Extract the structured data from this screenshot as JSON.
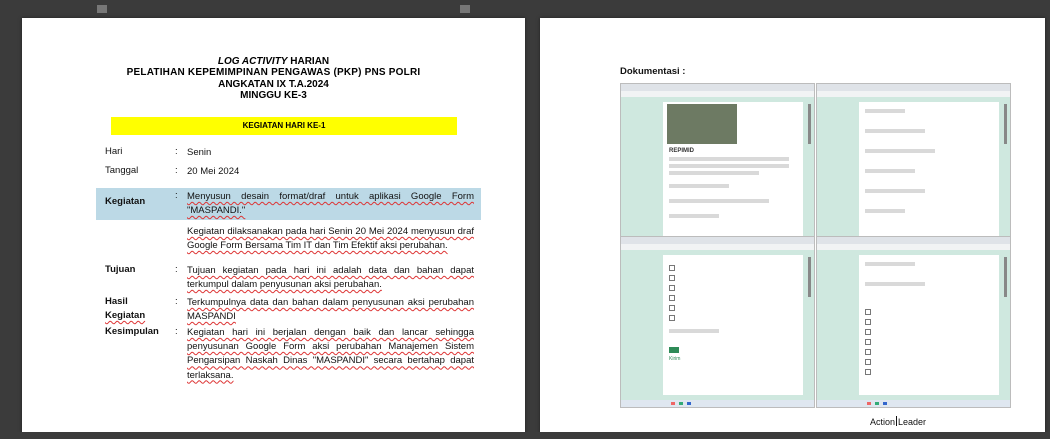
{
  "page1": {
    "title_italic": "LOG ACTIVITY",
    "title_rest": " HARIAN",
    "title_line2": "PELATIHAN KEPEMIMPINAN PENGAWAS (PKP) PNS POLRI",
    "title_line3": "ANGKATAN IX T.A.2024",
    "title_line4": "MINGGU KE-3",
    "day_banner": "KEGIATAN HARI KE-1",
    "rows": {
      "hari": {
        "label": "Hari",
        "value": "Senin"
      },
      "tanggal": {
        "label": "Tanggal",
        "value": "20 Mei 2024"
      },
      "kegiatan": {
        "label": "Kegiatan",
        "value": "Menyusun desain format/draf untuk aplikasi Google Form \"MASPANDI.\""
      },
      "kegiatan_detail": "Kegiatan dilaksanakan pada hari Senin 20 Mei 2024 menyusun draf Google Form Bersama Tim IT dan Tim Efektif aksi perubahan.",
      "tujuan": {
        "label": "Tujuan",
        "value": "Tujuan kegiatan pada hari ini adalah data dan bahan dapat terkumpul dalam penyusunan aksi perubahan."
      },
      "hasil": {
        "label1": "Hasil",
        "label2": "Kegiatan",
        "value": "Terkumpulnya data dan bahan dalam penyusunan aksi perubahan MASPANDI"
      },
      "kesimpulan": {
        "label": "Kesimpulan",
        "value": "Kegiatan hari ini berjalan dengan baik dan lancar sehingga penyusunan Google Form aksi perubahan Manajemen Sistem Pengarsipan Naskah Dinas \"MASPANDI\" secara bertahap dapat terlaksana."
      }
    },
    "colon": ":"
  },
  "page2": {
    "doc_label": "Dokumentasi  :",
    "action_text_1": "Action",
    "action_text_2": "Leader",
    "form_title": "REPIMID",
    "form_submit": "Kirim"
  },
  "colors": {
    "banner_yellow": "#ffff00",
    "kegiatan_blue": "#bcd9e6",
    "screenshot_bg": "#cfe8df"
  }
}
